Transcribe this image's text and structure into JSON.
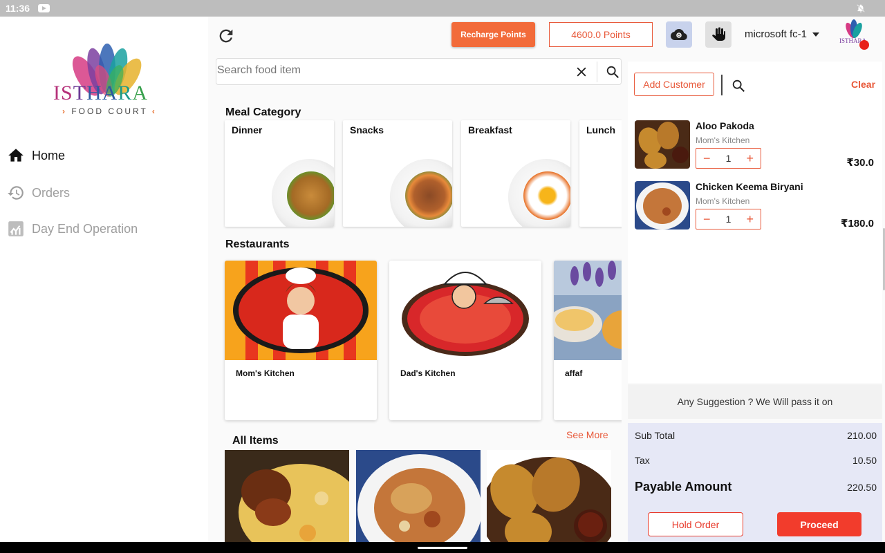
{
  "status_bar": {
    "time": "11:36",
    "icons": [
      "youtube-icon",
      "silent-icon"
    ]
  },
  "brand": {
    "name_letters": [
      "I",
      "S",
      "T",
      "H",
      "A",
      "R",
      "A"
    ],
    "tagline": "FOOD COURT"
  },
  "sidebar": {
    "items": [
      {
        "label": "Home",
        "icon": "home-icon",
        "active": true
      },
      {
        "label": "Orders",
        "icon": "history-icon",
        "active": false
      },
      {
        "label": "Day End Operation",
        "icon": "analytics-icon",
        "active": false
      }
    ]
  },
  "topbar": {
    "recharge_label": "Recharge Points",
    "points": "4600.0 Points",
    "device": "microsoft fc-1",
    "icons": [
      "refresh-icon",
      "cloud-sync-icon",
      "hand-icon",
      "profile-logo"
    ]
  },
  "search": {
    "placeholder": "Search food item"
  },
  "meal_category": {
    "title": "Meal Category",
    "items": [
      {
        "label": "Dinner"
      },
      {
        "label": "Snacks"
      },
      {
        "label": "Breakfast"
      },
      {
        "label": "Lunch"
      }
    ]
  },
  "restaurants": {
    "title": "Restaurants",
    "items": [
      {
        "name": "Mom's Kitchen"
      },
      {
        "name": "Dad's Kitchen"
      },
      {
        "name": "affaf"
      }
    ]
  },
  "all_items": {
    "title": "All Items",
    "see_more": "See More"
  },
  "cart": {
    "add_customer": "Add Customer",
    "clear": "Clear",
    "items": [
      {
        "title": "Aloo Pakoda",
        "restaurant": "Mom's Kitchen",
        "qty": "1",
        "price": "₹30.0"
      },
      {
        "title": "Chicken Keema Biryani",
        "restaurant": "Mom's Kitchen",
        "qty": "1",
        "price": "₹180.0"
      }
    ]
  },
  "suggestion": "Any Suggestion ? We Will pass it on",
  "totals": {
    "subtotal_label": "Sub Total",
    "subtotal": "210.00",
    "tax_label": "Tax",
    "tax": "10.50",
    "payable_label": "Payable Amount",
    "payable": "220.50"
  },
  "actions": {
    "hold": "Hold Order",
    "proceed": "Proceed"
  },
  "colors": {
    "accent": "#f26b3a",
    "danger": "#f23c2c",
    "totals_bg": "#e6e8f6",
    "active_cloud": "#c8d2ec"
  }
}
